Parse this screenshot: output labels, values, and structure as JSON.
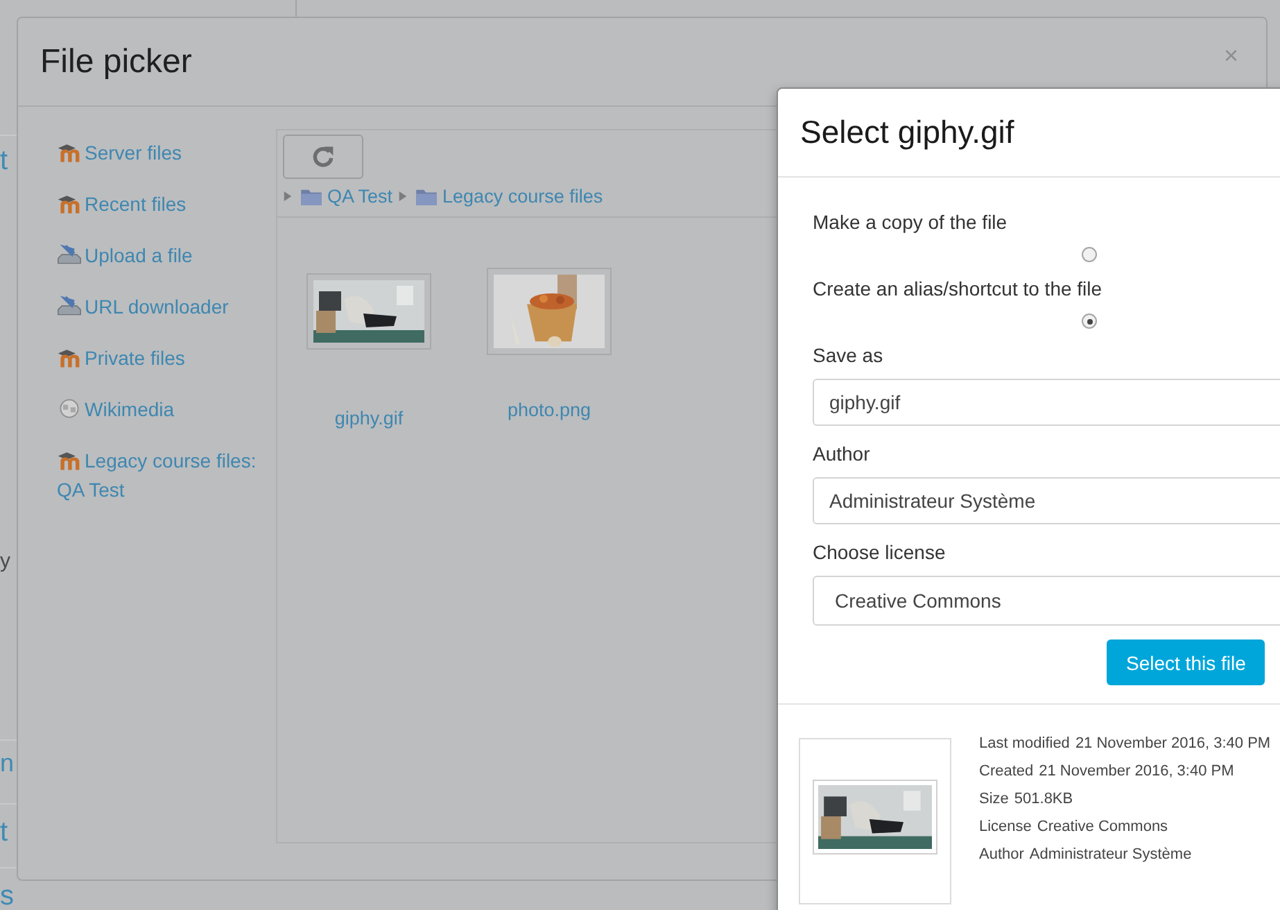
{
  "background_page": {
    "fragments": [
      {
        "text": "t",
        "kind": "link"
      },
      {
        "text": "y",
        "kind": "plain"
      },
      {
        "text": "n",
        "kind": "link"
      },
      {
        "text": "t",
        "kind": "link"
      },
      {
        "text": "s",
        "kind": "link"
      }
    ]
  },
  "file_picker": {
    "title": "File picker",
    "close": "×",
    "sources": [
      {
        "label": "Server files",
        "kind": "moodle"
      },
      {
        "label": "Recent files",
        "kind": "moodle"
      },
      {
        "label": "Upload a file",
        "kind": "upload"
      },
      {
        "label": "URL downloader",
        "kind": "upload"
      },
      {
        "label": "Private files",
        "kind": "moodle"
      },
      {
        "label": "Wikimedia",
        "kind": "wiki"
      },
      {
        "label": "Legacy course files: QA Test",
        "kind": "moodle"
      }
    ],
    "breadcrumb": [
      "QA Test",
      "Legacy course files"
    ],
    "files": [
      {
        "name": "giphy.gif",
        "kind": "picture"
      },
      {
        "name": "photo.png",
        "kind": "picture"
      }
    ]
  },
  "select_dialog": {
    "title": "Select giphy.gif",
    "options": [
      {
        "label": "Make a copy of the file",
        "selected": false
      },
      {
        "label": "Create an alias/shortcut to the file",
        "selected": true
      }
    ],
    "fields": [
      {
        "label": "Save as",
        "value": "giphy.gif",
        "kind": "text"
      },
      {
        "label": "Author",
        "value": "Administrateur Système",
        "kind": "text"
      },
      {
        "label": "Choose license",
        "value": "Creative Commons",
        "kind": "select"
      }
    ],
    "buttons": [
      "Select this file"
    ],
    "details": [
      {
        "label": "Last modified",
        "value": "21 November 2016, 3:40 PM"
      },
      {
        "label": "Created",
        "value": "21 November 2016, 3:40 PM"
      },
      {
        "label": "Size",
        "value": "501.8KB"
      },
      {
        "label": "License",
        "value": "Creative Commons"
      },
      {
        "label": "Author",
        "value": "Administrateur Système"
      }
    ]
  }
}
